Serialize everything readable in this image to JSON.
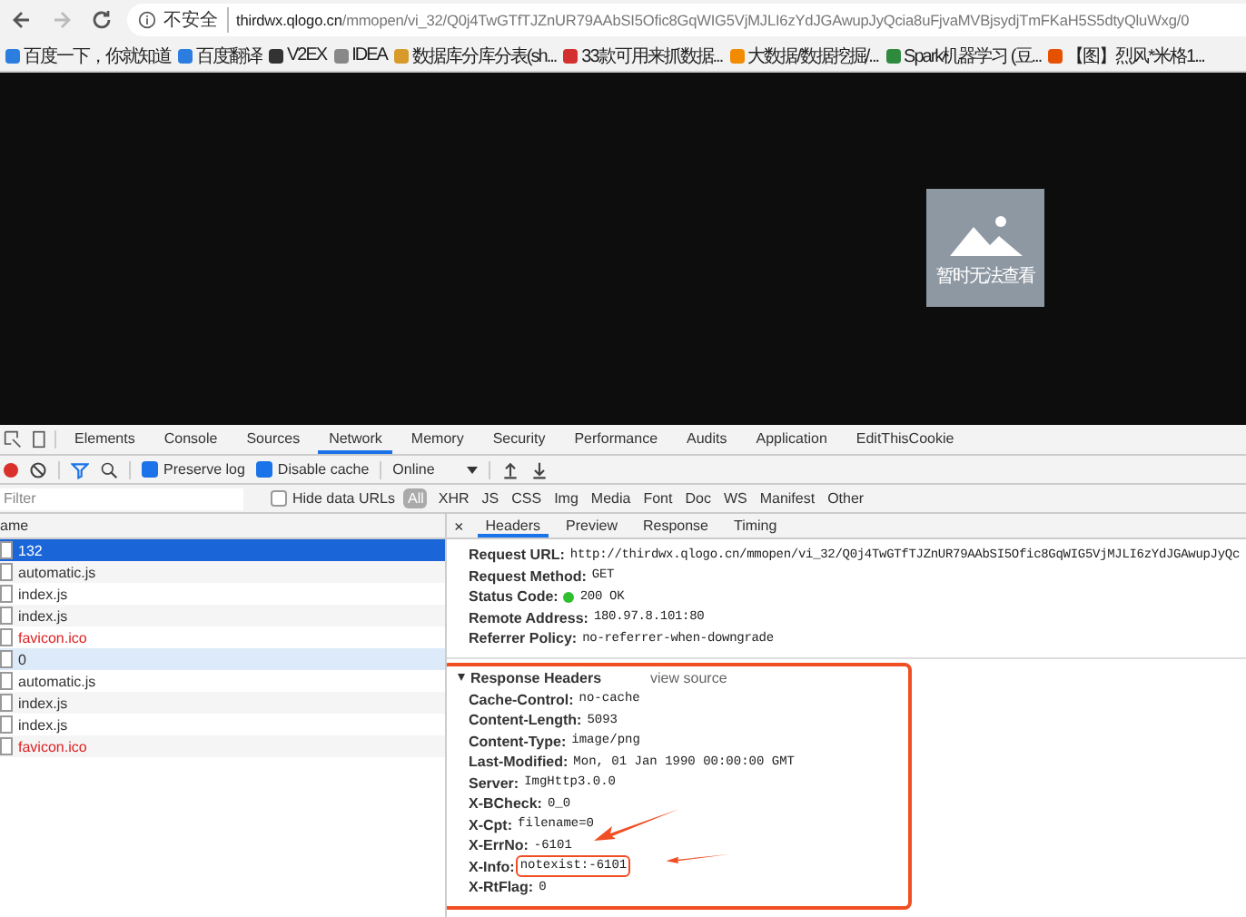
{
  "address_bar": {
    "security_label": "不安全",
    "host": "thirdwx.qlogo.cn",
    "path": "/mmopen/vi_32/Q0j4TwGTfTJZnUR79AAbSI5Ofic8GqWIG5VjMJLI6zYdJGAwupJyQcia8uFjvaMVBjsydjTmFKaH5S5dtyQluWxg/0"
  },
  "bookmarks": [
    {
      "label": "百度一下，你就知道"
    },
    {
      "label": "百度翻译"
    },
    {
      "label": "V2EX"
    },
    {
      "label": "IDEA"
    },
    {
      "label": "数据库分库分表(sh..."
    },
    {
      "label": "33款可用来抓数据..."
    },
    {
      "label": "大数据/数据挖掘/..."
    },
    {
      "label": "Spark机器学习 (豆..."
    },
    {
      "label": "【图】烈风*米格1..."
    }
  ],
  "page": {
    "image_caption": "暂时无法查看"
  },
  "devtools": {
    "tabs": [
      {
        "label": "Elements",
        "selected": false
      },
      {
        "label": "Console",
        "selected": false
      },
      {
        "label": "Sources",
        "selected": false
      },
      {
        "label": "Network",
        "selected": true
      },
      {
        "label": "Memory",
        "selected": false
      },
      {
        "label": "Security",
        "selected": false
      },
      {
        "label": "Performance",
        "selected": false
      },
      {
        "label": "Audits",
        "selected": false
      },
      {
        "label": "Application",
        "selected": false
      },
      {
        "label": "EditThisCookie",
        "selected": false
      }
    ],
    "toolbar": {
      "recording": true,
      "preserve_log": {
        "label": "Preserve log",
        "checked": true
      },
      "disable_cache": {
        "label": "Disable cache",
        "checked": true
      },
      "throttling": "Online"
    },
    "filter": {
      "placeholder": "Filter",
      "hide_data_urls": {
        "label": "Hide data URLs",
        "checked": false
      },
      "types": [
        {
          "label": "All",
          "selected": true
        },
        {
          "label": "XHR",
          "selected": false
        },
        {
          "label": "JS",
          "selected": false
        },
        {
          "label": "CSS",
          "selected": false
        },
        {
          "label": "Img",
          "selected": false
        },
        {
          "label": "Media",
          "selected": false
        },
        {
          "label": "Font",
          "selected": false
        },
        {
          "label": "Doc",
          "selected": false
        },
        {
          "label": "WS",
          "selected": false
        },
        {
          "label": "Manifest",
          "selected": false
        },
        {
          "label": "Other",
          "selected": false
        }
      ]
    },
    "requests_header": "ame",
    "requests": [
      {
        "name": "132",
        "selected": true,
        "highlighted": false,
        "error": false
      },
      {
        "name": "automatic.js",
        "selected": false,
        "highlighted": false,
        "error": false
      },
      {
        "name": "index.js",
        "selected": false,
        "highlighted": false,
        "error": false
      },
      {
        "name": "index.js",
        "selected": false,
        "highlighted": false,
        "error": false
      },
      {
        "name": "favicon.ico",
        "selected": false,
        "highlighted": false,
        "error": true
      },
      {
        "name": "0",
        "selected": false,
        "highlighted": true,
        "error": false
      },
      {
        "name": "automatic.js",
        "selected": false,
        "highlighted": false,
        "error": false
      },
      {
        "name": "index.js",
        "selected": false,
        "highlighted": false,
        "error": false
      },
      {
        "name": "index.js",
        "selected": false,
        "highlighted": false,
        "error": false
      },
      {
        "name": "favicon.ico",
        "selected": false,
        "highlighted": false,
        "error": true
      }
    ],
    "detail": {
      "close": "×",
      "tabs": [
        {
          "label": "Headers",
          "selected": true
        },
        {
          "label": "Preview",
          "selected": false
        },
        {
          "label": "Response",
          "selected": false
        },
        {
          "label": "Timing",
          "selected": false
        }
      ],
      "general": [
        {
          "key": "Request URL:",
          "value": "http://thirdwx.qlogo.cn/mmopen/vi_32/Q0j4TwGTfTJZnUR79AAbSI5Ofic8GqWIG5VjMJLI6zYdJGAwupJyQc",
          "kind": "text"
        },
        {
          "key": "Request Method:",
          "value": "GET",
          "kind": "text"
        },
        {
          "key": "Status Code:",
          "value": "200 OK",
          "kind": "status",
          "color": "#2ec02e"
        },
        {
          "key": "Remote Address:",
          "value": "180.97.8.101:80",
          "kind": "text"
        },
        {
          "key": "Referrer Policy:",
          "value": "no-referrer-when-downgrade",
          "kind": "text"
        }
      ],
      "response_headers": {
        "title": "Response Headers",
        "expanded": true,
        "view_source": "view source",
        "items": [
          {
            "key": "Cache-Control:",
            "value": "no-cache",
            "marked": false,
            "pointed": false
          },
          {
            "key": "Content-Length:",
            "value": "5093",
            "marked": false,
            "pointed": false
          },
          {
            "key": "Content-Type:",
            "value": "image/png",
            "marked": false,
            "pointed": false
          },
          {
            "key": "Last-Modified:",
            "value": "Mon, 01 Jan 1990 00:00:00 GMT",
            "marked": false,
            "pointed": false
          },
          {
            "key": "Server:",
            "value": "ImgHttp3.0.0",
            "marked": false,
            "pointed": false
          },
          {
            "key": "X-BCheck:",
            "value": "0_0",
            "marked": false,
            "pointed": false
          },
          {
            "key": "X-Cpt:",
            "value": "filename=0",
            "marked": false,
            "pointed": false
          },
          {
            "key": "X-ErrNo:",
            "value": "-6101",
            "marked": false,
            "pointed": true
          },
          {
            "key": "X-Info:",
            "value": "notexist:-6101",
            "marked": true,
            "pointed": true
          },
          {
            "key": "X-RtFlag:",
            "value": "0",
            "marked": false,
            "pointed": false
          }
        ]
      }
    }
  }
}
